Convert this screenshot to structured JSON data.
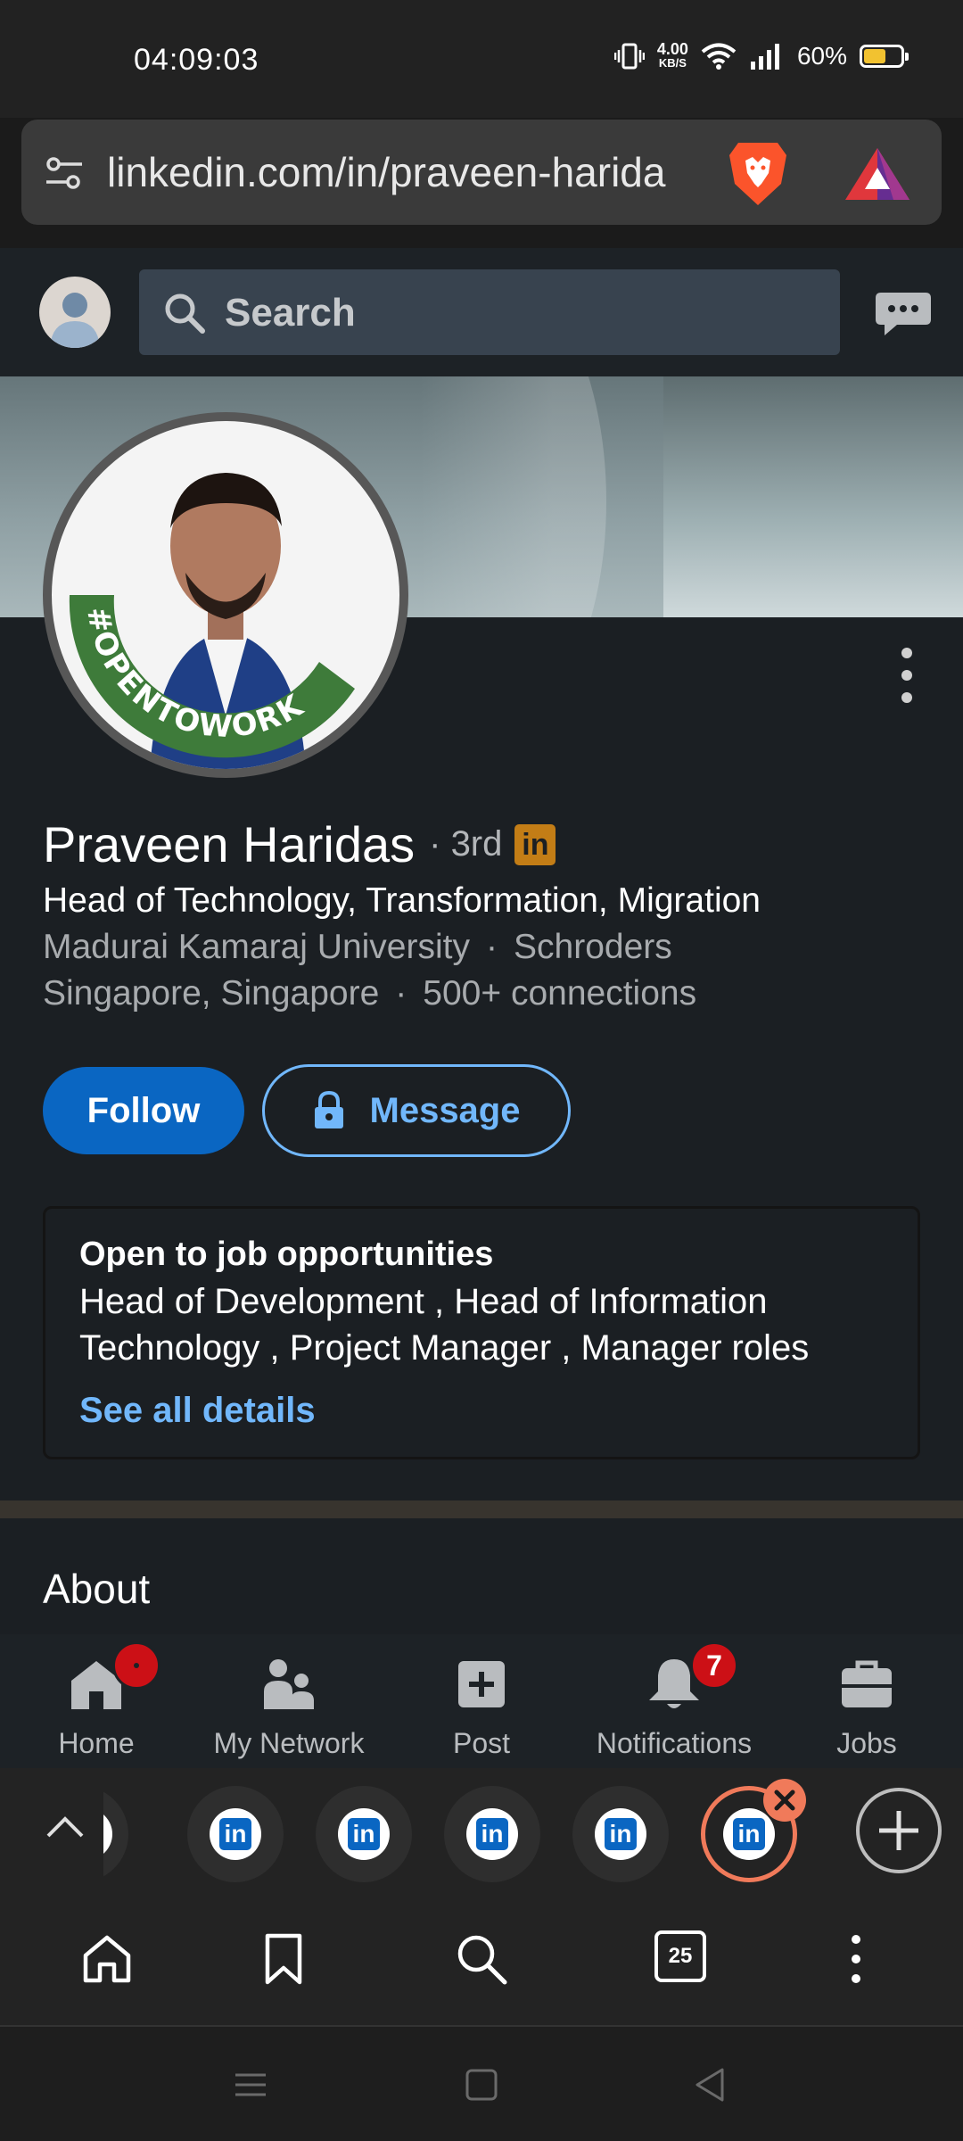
{
  "status_bar": {
    "time": "04:09:03",
    "net_speed_value": "4.00",
    "net_speed_unit": "KB/S",
    "battery": "60%",
    "battery_level": 0.6
  },
  "browser": {
    "url": "linkedin.com/in/praveen-harida",
    "tab_count": "25"
  },
  "linkedin_header": {
    "search_placeholder": "Search"
  },
  "profile": {
    "name": "Praveen Haridas",
    "dot": "·",
    "degree": "3rd",
    "badge_letters": "in",
    "photo_frame_text": "#OPENTOWORK",
    "headline": "Head of Technology, Transformation, Migration",
    "education": "Madurai Kamaraj University",
    "company": "Schroders",
    "location": "Singapore, Singapore",
    "connections": "500+ connections",
    "separator": "·",
    "follow_label": "Follow",
    "message_label": "Message"
  },
  "open_to_work": {
    "title": "Open to job opportunities",
    "body": "Head of Development , Head of Information Technology , Project Manager , Manager roles",
    "link": "See all details"
  },
  "about": {
    "title": "About"
  },
  "linkedin_nav": [
    {
      "label": "Home",
      "icon": "home-icon",
      "badge": ""
    },
    {
      "label": "My Network",
      "icon": "network-icon",
      "badge": ""
    },
    {
      "label": "Post",
      "icon": "post-icon",
      "badge": ""
    },
    {
      "label": "Notifications",
      "icon": "bell-icon",
      "badge": "7"
    },
    {
      "label": "Jobs",
      "icon": "briefcase-icon",
      "badge": ""
    }
  ],
  "tabs": {
    "tab_icon_letters": "in",
    "count_visible": 5
  },
  "colors": {
    "linkedin_blue": "#0a66c2",
    "link_blue": "#71b7fb",
    "notification_red": "#cc1016",
    "active_tab_ring": "#f07a5a",
    "open_to_work_green": "#3e7b3a"
  }
}
